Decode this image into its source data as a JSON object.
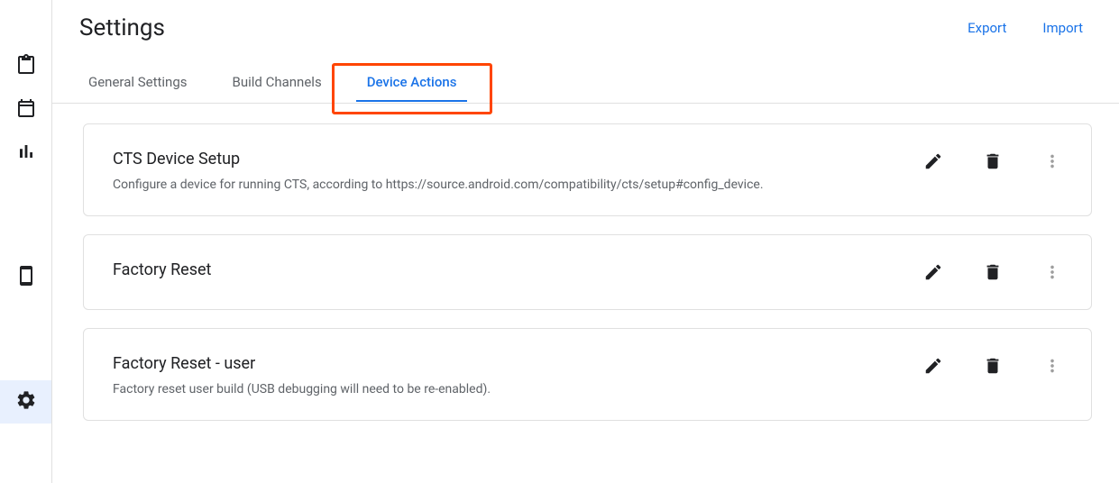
{
  "page": {
    "title": "Settings"
  },
  "toplinks": {
    "export": "Export",
    "import": "Import"
  },
  "tabs": {
    "general": "General Settings",
    "build": "Build Channels",
    "device": "Device Actions"
  },
  "cards": [
    {
      "title": "CTS Device Setup",
      "desc": "Configure a device for running CTS, according to https://source.android.com/compatibility/cts/setup#config_device."
    },
    {
      "title": "Factory Reset",
      "desc": ""
    },
    {
      "title": "Factory Reset - user",
      "desc": "Factory reset user build (USB debugging will need to be re-enabled)."
    }
  ]
}
